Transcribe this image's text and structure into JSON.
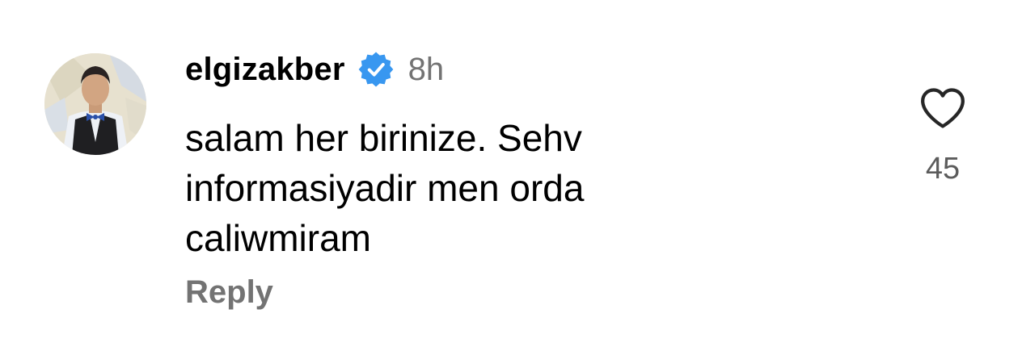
{
  "comment": {
    "username": "elgizakber",
    "verified": true,
    "time_ago": "8h",
    "text_lines": [
      "salam her birinize. Sehv",
      "informasiyadir men orda",
      "caliwmiram"
    ],
    "reply_label": "Reply",
    "like_count": "45"
  },
  "icons": {
    "verified": "verified-badge-icon",
    "like": "heart-outline-icon"
  },
  "colors": {
    "verified_badge": "#3897f0",
    "secondary_text": "#737373",
    "primary_text": "#000000"
  }
}
